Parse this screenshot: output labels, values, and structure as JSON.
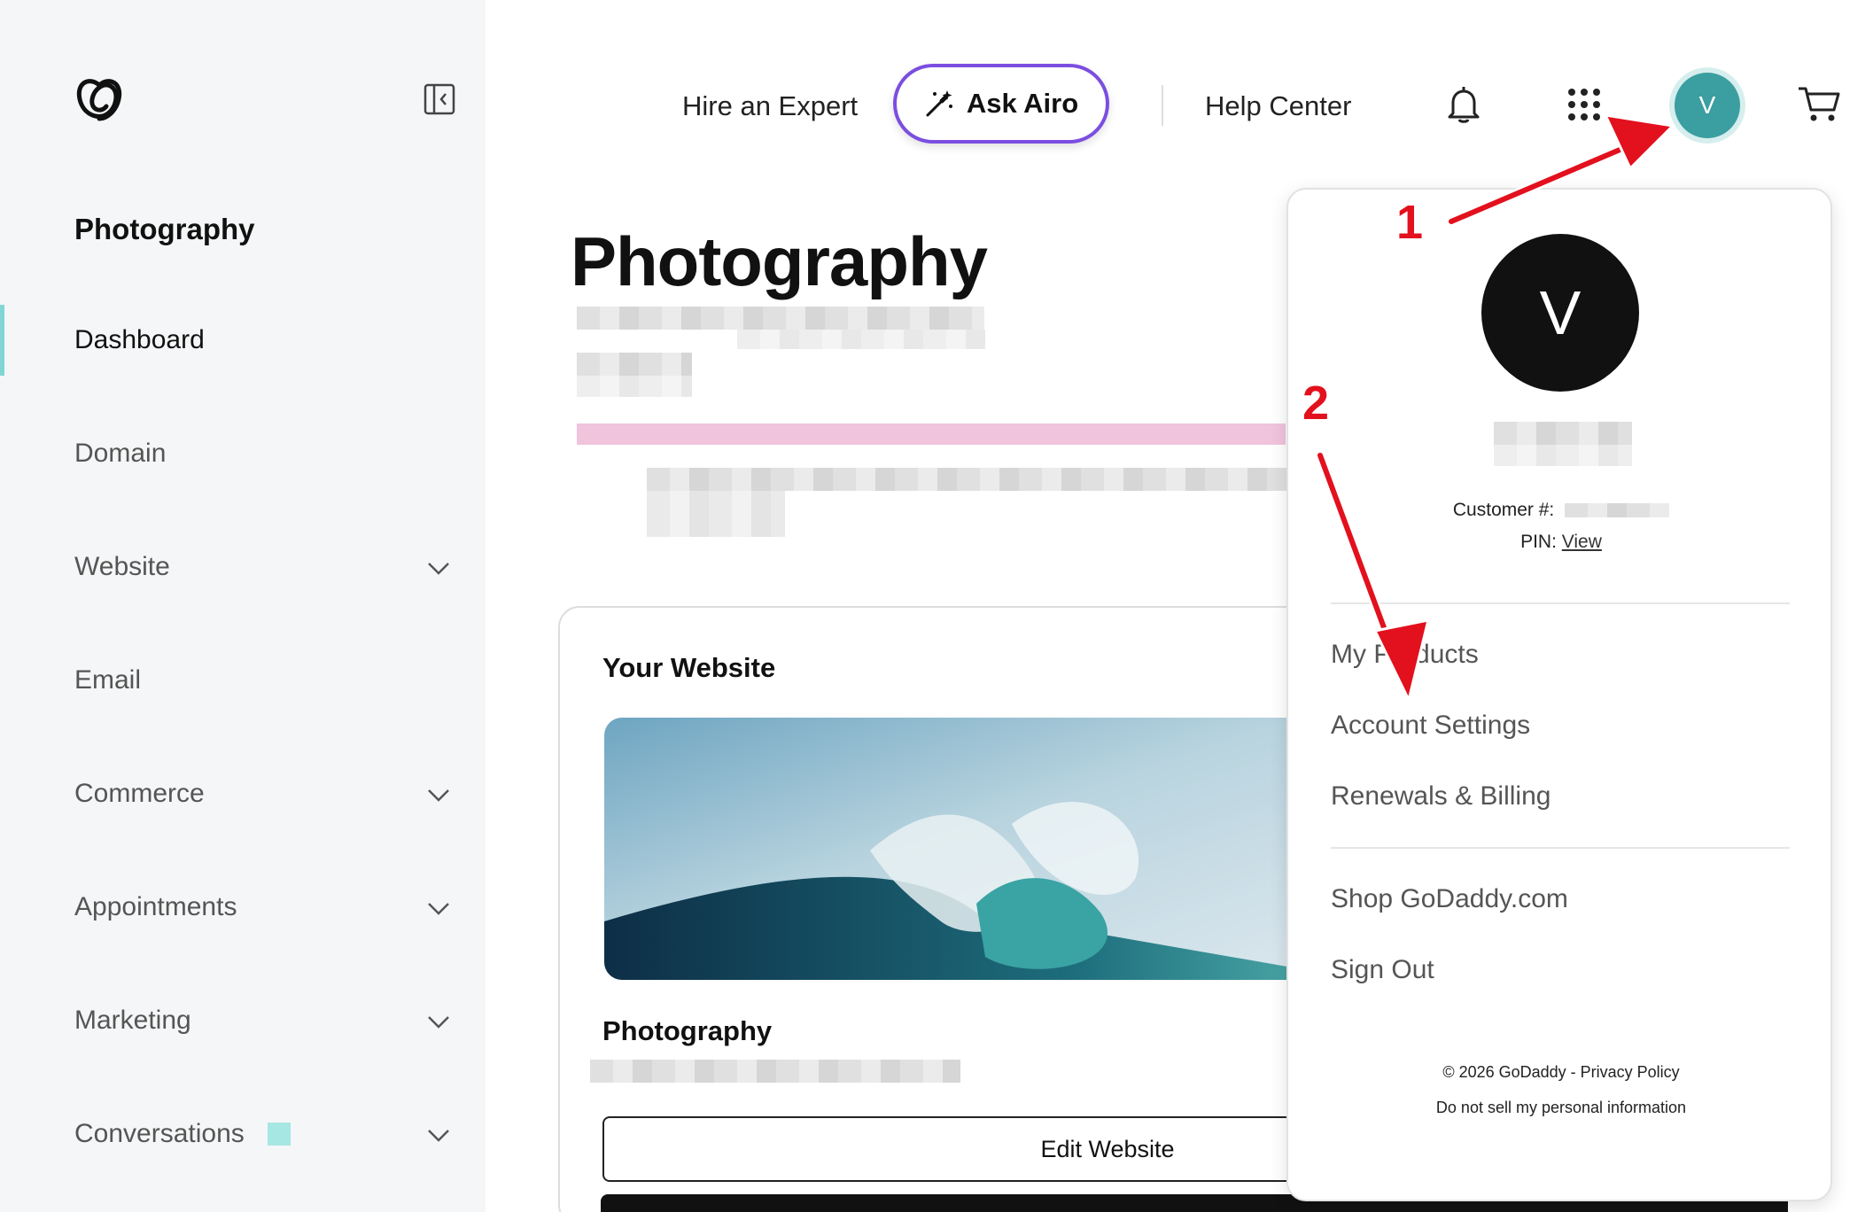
{
  "sidebar": {
    "logo_icon": "godaddy-logo-icon",
    "collapse_icon": "sidebar-collapse-icon",
    "site_name": "Photography",
    "items": [
      {
        "label": "Dashboard",
        "active": true,
        "chevron": false
      },
      {
        "label": "Domain",
        "active": false,
        "chevron": false
      },
      {
        "label": "Website",
        "active": false,
        "chevron": true
      },
      {
        "label": "Email",
        "active": false,
        "chevron": false
      },
      {
        "label": "Commerce",
        "active": false,
        "chevron": true
      },
      {
        "label": "Appointments",
        "active": false,
        "chevron": true
      },
      {
        "label": "Marketing",
        "active": false,
        "chevron": true
      },
      {
        "label": "Conversations",
        "active": false,
        "chevron": true
      }
    ]
  },
  "header": {
    "hire_expert": "Hire an Expert",
    "ask_airo": "Ask Airo",
    "help_center": "Help Center",
    "avatar_initial": "V",
    "icons": [
      "magic-wand-icon",
      "bell-icon",
      "apps-grid-icon",
      "cart-icon"
    ]
  },
  "main": {
    "page_title": "Photography",
    "card": {
      "title": "Your Website",
      "site_name": "Photography",
      "edit_button": "Edit Website"
    }
  },
  "dropdown": {
    "avatar_initial": "V",
    "customer_label": "Customer #:",
    "pin_label": "PIN:",
    "pin_link": "View",
    "menu_group_1": [
      "My Products",
      "Account Settings",
      "Renewals & Billing"
    ],
    "menu_group_2": [
      "Shop GoDaddy.com",
      "Sign Out"
    ],
    "footer_line_1": "© 2026 GoDaddy - Privacy Policy",
    "footer_line_2": "Do not sell my personal information"
  },
  "annotations": {
    "step_1": "1",
    "step_2": "2",
    "arrow_color": "#e3101d"
  },
  "colors": {
    "accent_purple": "#7b4ee0",
    "avatar_teal": "#3b9ea0",
    "active_indicator": "#7fd6d5"
  }
}
